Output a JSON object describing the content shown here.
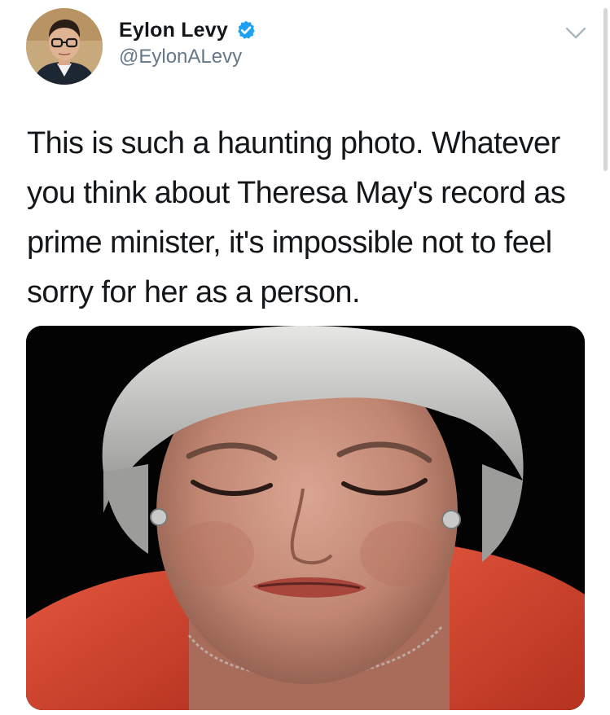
{
  "tweet": {
    "author": {
      "display_name": "Eylon Levy",
      "handle": "@EylonALevy",
      "verified": true,
      "avatar_icon": "profile-photo"
    },
    "text": "This is such a haunting photo. Whatever you think about Theresa May's record as prime minister, it's impossible not to feel sorry for her as a person.",
    "media": {
      "kind": "photo",
      "icon": "photo-crying-woman"
    },
    "menu_icon": "chevron-down-icon"
  },
  "colors": {
    "name_text": "#14171a",
    "handle_text": "#657786",
    "verified_badge": "#1da1f2",
    "chevron": "#aab8c2",
    "background": "#ffffff"
  }
}
